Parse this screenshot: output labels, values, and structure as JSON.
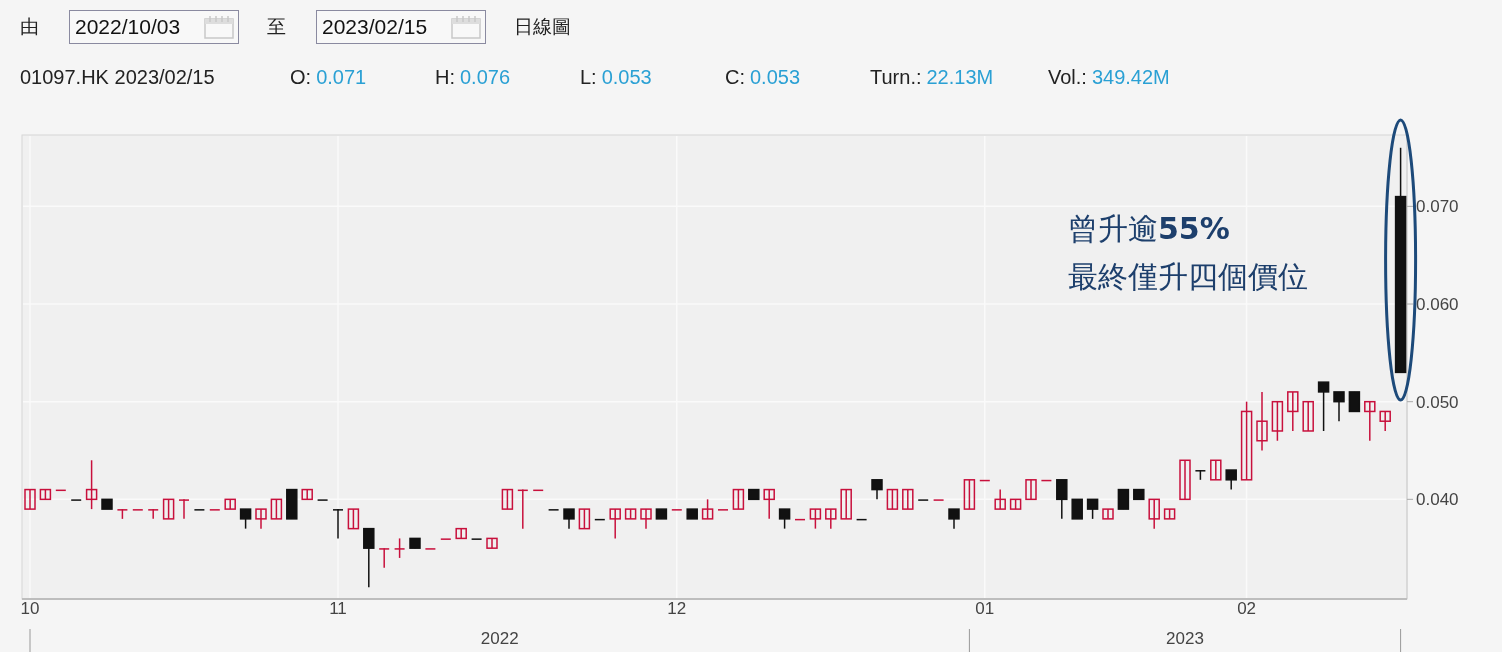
{
  "controls": {
    "from_label": "由",
    "from_date": "2022/10/03",
    "to_label": "至",
    "to_date": "2023/02/15",
    "chart_type": "日線圖"
  },
  "quote": {
    "symbol": "01097.HK 2023/02/15",
    "fields": [
      {
        "label": "O:",
        "value": "0.071"
      },
      {
        "label": "H:",
        "value": "0.076"
      },
      {
        "label": "L:",
        "value": "0.053"
      },
      {
        "label": "C:",
        "value": "0.053"
      },
      {
        "label": "Turn.:",
        "value": "22.13M"
      },
      {
        "label": "Vol.:",
        "value": "349.42M"
      }
    ]
  },
  "chart": {
    "chart_data": {
      "type": "candlestick",
      "grid": true,
      "ylim": [
        0.03,
        0.077
      ],
      "yticks": [
        {
          "value": 0.07,
          "label": "0.070"
        },
        {
          "value": 0.06,
          "label": "0.060"
        },
        {
          "value": 0.05,
          "label": "0.050"
        },
        {
          "value": 0.04,
          "label": "0.040"
        }
      ],
      "categories": [
        "10",
        null,
        null,
        null,
        null,
        null,
        null,
        null,
        null,
        null,
        null,
        null,
        null,
        null,
        null,
        null,
        null,
        null,
        null,
        null,
        "11",
        null,
        null,
        null,
        null,
        null,
        null,
        null,
        null,
        null,
        null,
        null,
        null,
        null,
        null,
        null,
        null,
        null,
        null,
        null,
        null,
        null,
        "12",
        null,
        null,
        null,
        null,
        null,
        null,
        null,
        null,
        null,
        null,
        null,
        null,
        null,
        null,
        null,
        null,
        null,
        null,
        null,
        "01",
        null,
        null,
        null,
        null,
        null,
        null,
        null,
        null,
        null,
        null,
        null,
        null,
        null,
        null,
        null,
        null,
        "02",
        null,
        null,
        null,
        null,
        null,
        null,
        null,
        null,
        null,
        null
      ],
      "ohlc": [
        [
          0.039,
          0.041,
          0.039,
          0.041
        ],
        [
          0.04,
          0.041,
          0.04,
          0.041
        ],
        [
          0.041,
          0.041,
          0.041,
          0.041
        ],
        [
          0.04,
          0.04,
          0.04,
          0.04
        ],
        [
          0.04,
          0.044,
          0.039,
          0.041
        ],
        [
          0.04,
          0.04,
          0.039,
          0.039
        ],
        [
          0.039,
          0.039,
          0.038,
          0.039
        ],
        [
          0.039,
          0.039,
          0.039,
          0.039
        ],
        [
          0.039,
          0.039,
          0.038,
          0.039
        ],
        [
          0.038,
          0.04,
          0.038,
          0.04
        ],
        [
          0.04,
          0.04,
          0.038,
          0.04
        ],
        [
          0.039,
          0.039,
          0.039,
          0.039
        ],
        [
          0.039,
          0.039,
          0.039,
          0.039
        ],
        [
          0.039,
          0.04,
          0.039,
          0.04
        ],
        [
          0.039,
          0.039,
          0.037,
          0.038
        ],
        [
          0.038,
          0.039,
          0.037,
          0.039
        ],
        [
          0.038,
          0.04,
          0.038,
          0.04
        ],
        [
          0.041,
          0.041,
          0.038,
          0.038
        ],
        [
          0.04,
          0.041,
          0.04,
          0.041
        ],
        [
          0.04,
          0.04,
          0.04,
          0.04
        ],
        [
          0.039,
          0.039,
          0.036,
          0.039
        ],
        [
          0.037,
          0.039,
          0.037,
          0.039
        ],
        [
          0.037,
          0.037,
          0.031,
          0.035
        ],
        [
          0.035,
          0.035,
          0.033,
          0.035
        ],
        [
          0.035,
          0.036,
          0.034,
          0.035
        ],
        [
          0.036,
          0.036,
          0.035,
          0.035
        ],
        [
          0.035,
          0.035,
          0.035,
          0.035
        ],
        [
          0.036,
          0.036,
          0.036,
          0.036
        ],
        [
          0.036,
          0.037,
          0.036,
          0.037
        ],
        [
          0.036,
          0.036,
          0.036,
          0.036
        ],
        [
          0.035,
          0.036,
          0.035,
          0.036
        ],
        [
          0.039,
          0.041,
          0.039,
          0.041
        ],
        [
          0.041,
          0.041,
          0.037,
          0.041
        ],
        [
          0.041,
          0.041,
          0.041,
          0.041
        ],
        [
          0.039,
          0.039,
          0.039,
          0.039
        ],
        [
          0.039,
          0.039,
          0.037,
          0.038
        ],
        [
          0.037,
          0.039,
          0.037,
          0.039
        ],
        [
          0.038,
          0.038,
          0.038,
          0.038
        ],
        [
          0.038,
          0.039,
          0.036,
          0.039
        ],
        [
          0.038,
          0.039,
          0.038,
          0.039
        ],
        [
          0.038,
          0.039,
          0.037,
          0.039
        ],
        [
          0.039,
          0.039,
          0.038,
          0.038
        ],
        [
          0.039,
          0.039,
          0.039,
          0.039
        ],
        [
          0.039,
          0.039,
          0.038,
          0.038
        ],
        [
          0.038,
          0.04,
          0.038,
          0.039
        ],
        [
          0.039,
          0.039,
          0.039,
          0.039
        ],
        [
          0.039,
          0.041,
          0.039,
          0.041
        ],
        [
          0.041,
          0.041,
          0.04,
          0.04
        ],
        [
          0.04,
          0.041,
          0.038,
          0.041
        ],
        [
          0.039,
          0.039,
          0.037,
          0.038
        ],
        [
          0.038,
          0.038,
          0.038,
          0.038
        ],
        [
          0.038,
          0.039,
          0.037,
          0.039
        ],
        [
          0.038,
          0.039,
          0.037,
          0.039
        ],
        [
          0.038,
          0.041,
          0.038,
          0.041
        ],
        [
          0.038,
          0.038,
          0.038,
          0.038
        ],
        [
          0.042,
          0.042,
          0.04,
          0.041
        ],
        [
          0.039,
          0.041,
          0.039,
          0.041
        ],
        [
          0.039,
          0.041,
          0.039,
          0.041
        ],
        [
          0.04,
          0.04,
          0.04,
          0.04
        ],
        [
          0.04,
          0.04,
          0.04,
          0.04
        ],
        [
          0.039,
          0.039,
          0.037,
          0.038
        ],
        [
          0.039,
          0.042,
          0.039,
          0.042
        ],
        [
          0.042,
          0.042,
          0.042,
          0.042
        ],
        [
          0.039,
          0.041,
          0.039,
          0.04
        ],
        [
          0.039,
          0.04,
          0.039,
          0.04
        ],
        [
          0.04,
          0.042,
          0.04,
          0.042
        ],
        [
          0.042,
          0.042,
          0.042,
          0.042
        ],
        [
          0.042,
          0.042,
          0.038,
          0.04
        ],
        [
          0.04,
          0.04,
          0.038,
          0.038
        ],
        [
          0.04,
          0.04,
          0.038,
          0.039
        ],
        [
          0.038,
          0.039,
          0.038,
          0.039
        ],
        [
          0.041,
          0.041,
          0.039,
          0.039
        ],
        [
          0.041,
          0.041,
          0.04,
          0.04
        ],
        [
          0.038,
          0.04,
          0.037,
          0.04
        ],
        [
          0.038,
          0.039,
          0.038,
          0.039
        ],
        [
          0.04,
          0.044,
          0.04,
          0.044
        ],
        [
          0.043,
          0.043,
          0.042,
          0.043
        ],
        [
          0.042,
          0.044,
          0.042,
          0.044
        ],
        [
          0.043,
          0.043,
          0.041,
          0.042
        ],
        [
          0.042,
          0.05,
          0.042,
          0.049
        ],
        [
          0.046,
          0.051,
          0.045,
          0.048
        ],
        [
          0.047,
          0.05,
          0.046,
          0.05
        ],
        [
          0.049,
          0.051,
          0.047,
          0.051
        ],
        [
          0.047,
          0.05,
          0.047,
          0.05
        ],
        [
          0.052,
          0.052,
          0.047,
          0.051
        ],
        [
          0.051,
          0.051,
          0.048,
          0.05
        ],
        [
          0.051,
          0.051,
          0.049,
          0.049
        ],
        [
          0.049,
          0.05,
          0.046,
          0.05
        ],
        [
          0.048,
          0.049,
          0.047,
          0.049
        ],
        [
          0.071,
          0.076,
          0.053,
          0.053
        ]
      ]
    },
    "year_labels": [
      "2022",
      "2023"
    ],
    "callout": {
      "lines": [
        "曾升逾**55%**",
        "最終僅升四個價位"
      ]
    }
  }
}
